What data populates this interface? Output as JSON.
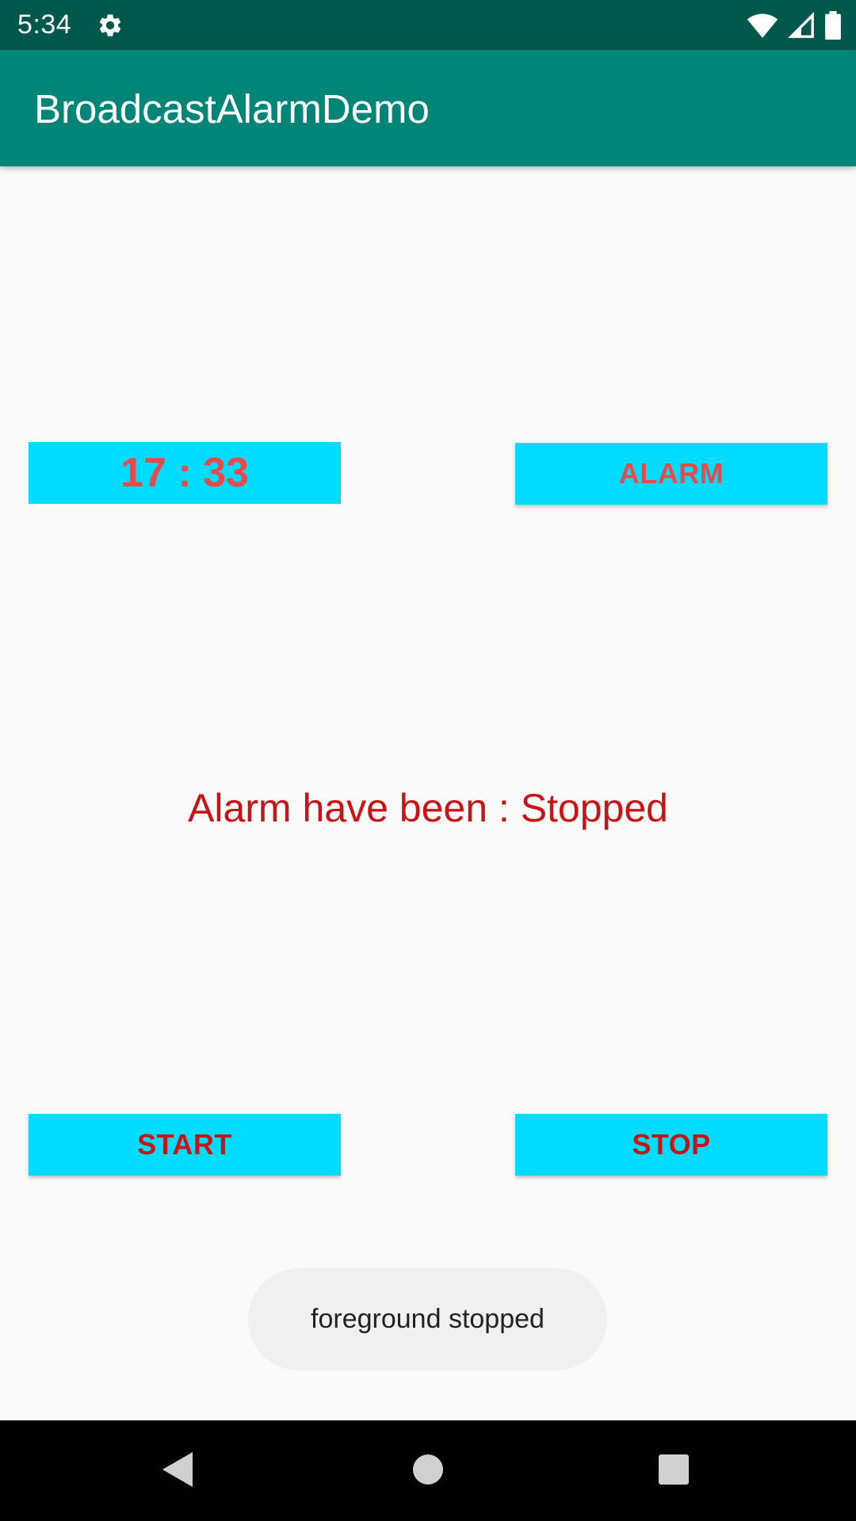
{
  "status_bar": {
    "time": "5:34",
    "icons": [
      "gear-icon",
      "wifi-icon",
      "signal-icon",
      "battery-icon"
    ],
    "background": "#00574b"
  },
  "app_bar": {
    "title": "BroadcastAlarmDemo",
    "background": "#008577"
  },
  "main": {
    "time_display": "17 : 33",
    "alarm_button_label": "ALARM",
    "status_message": "Alarm have been : Stopped",
    "start_button_label": "START",
    "stop_button_label": "STOP",
    "button_background": "#00dcff",
    "label_color": "#e84a4a",
    "message_color": "#c81414"
  },
  "toast": {
    "text": "foreground stopped"
  },
  "nav_bar": {
    "icons": [
      "back-icon",
      "home-icon",
      "recents-icon"
    ]
  }
}
